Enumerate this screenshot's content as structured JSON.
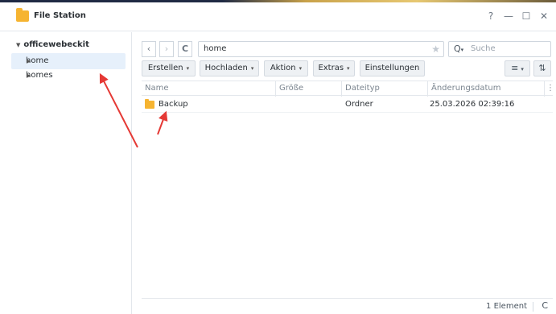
{
  "window": {
    "title": "File Station",
    "help_icon": "?",
    "minimize_icon": "—",
    "maximize_icon": "☐",
    "close_icon": "✕"
  },
  "sidebar": {
    "root": "officewebeckit",
    "items": [
      {
        "label": "home",
        "selected": true
      },
      {
        "label": "homes",
        "selected": false
      }
    ]
  },
  "nav": {
    "back_icon": "‹",
    "forward_icon": "›",
    "refresh_icon": "C",
    "path": "home",
    "favorite_icon": "★",
    "search_icon": "Q",
    "search_placeholder": "Suche"
  },
  "toolbar": {
    "create": "Erstellen",
    "upload": "Hochladen",
    "action": "Aktion",
    "extras": "Extras",
    "settings": "Einstellungen",
    "list_view_icon": "≡",
    "sort_icon": "⇅"
  },
  "table": {
    "columns": [
      "Name",
      "Größe",
      "Dateityp",
      "Änderungsdatum"
    ],
    "rows": [
      {
        "name": "Backup",
        "size": "",
        "type": "Ordner",
        "modified": "25.03.2026 02:39:16"
      }
    ]
  },
  "footer": {
    "count": "1 Element",
    "refresh_icon": "C"
  },
  "colors": {
    "accent_arrow": "#e53935",
    "folder": "#f6b431",
    "selection": "#e6f0fb"
  }
}
